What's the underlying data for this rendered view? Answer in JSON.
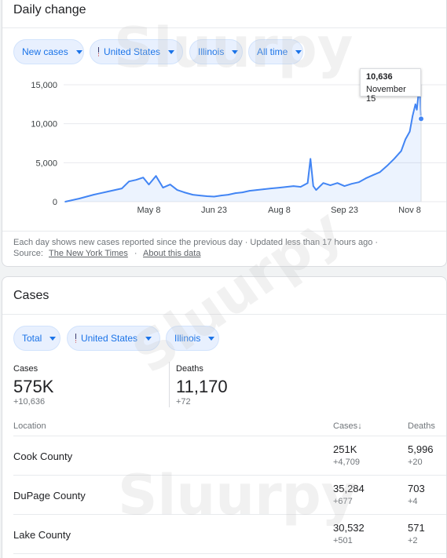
{
  "daily_change": {
    "title": "Daily change",
    "filters": {
      "metric": "New cases",
      "country": "United States",
      "region": "Illinois",
      "range": "All time"
    },
    "tooltip": {
      "value": "10,636",
      "date": "November 15"
    },
    "footer": {
      "note": "Each day shows new cases reported since the previous day · Updated less than 17 hours ago ·",
      "source_label": "Source:",
      "source_link": "The New York Times",
      "separator": "·",
      "about_link": "About this data"
    }
  },
  "chart_data": {
    "type": "line",
    "title": "",
    "xlabel": "",
    "ylabel": "",
    "y_ticks": [
      "15,000",
      "10,000",
      "5,000",
      "0"
    ],
    "x_ticks": [
      "May 8",
      "Jun 23",
      "Aug 8",
      "Sep 23",
      "Nov 8"
    ],
    "ylim": [
      0,
      15000
    ],
    "grid": true,
    "series": [
      {
        "color": "#4285f4",
        "x": [
          "Mar 10",
          "Mar 20",
          "Mar 30",
          "Apr 9",
          "Apr 19",
          "Apr 24",
          "Apr 29",
          "May 4",
          "May 8",
          "May 13",
          "May 18",
          "May 23",
          "May 28",
          "Jun 2",
          "Jun 8",
          "Jun 13",
          "Jun 18",
          "Jun 23",
          "Jun 28",
          "Jul 3",
          "Jul 8",
          "Jul 13",
          "Jul 18",
          "Jul 23",
          "Jul 28",
          "Aug 2",
          "Aug 8",
          "Aug 13",
          "Aug 18",
          "Aug 23",
          "Aug 28",
          "Aug 30",
          "Sep 1",
          "Sep 3",
          "Sep 8",
          "Sep 13",
          "Sep 18",
          "Sep 23",
          "Sep 28",
          "Oct 3",
          "Oct 8",
          "Oct 13",
          "Oct 18",
          "Oct 23",
          "Oct 28",
          "Nov 2",
          "Nov 5",
          "Nov 8",
          "Nov 10",
          "Nov 12",
          "Nov 13",
          "Nov 14",
          "Nov 15",
          "Nov 16"
        ],
        "values": [
          0,
          400,
          900,
          1300,
          1700,
          2600,
          2800,
          3100,
          2200,
          3300,
          1800,
          2200,
          1500,
          1200,
          900,
          800,
          700,
          650,
          800,
          900,
          1100,
          1200,
          1400,
          1500,
          1600,
          1700,
          1800,
          1900,
          2000,
          1900,
          2400,
          5500,
          2000,
          1500,
          2400,
          2100,
          2400,
          2000,
          2300,
          2500,
          3000,
          3400,
          3800,
          4600,
          5500,
          6500,
          8000,
          9000,
          11000,
          12500,
          11800,
          13500,
          15000,
          10636
        ]
      }
    ]
  },
  "cases_section": {
    "title": "Cases",
    "filters": {
      "metric": "Total",
      "country": "United States",
      "region": "Illinois"
    },
    "stats": {
      "cases": {
        "label": "Cases",
        "value": "575K",
        "delta": "+10,636"
      },
      "deaths": {
        "label": "Deaths",
        "value": "11,170",
        "delta": "+72"
      }
    },
    "table": {
      "headers": {
        "location": "Location",
        "cases": "Cases",
        "deaths": "Deaths"
      },
      "rows": [
        {
          "location": "Cook County",
          "cases": "251K",
          "cases_delta": "+4,709",
          "deaths": "5,996",
          "deaths_delta": "+20"
        },
        {
          "location": "DuPage County",
          "cases": "35,284",
          "cases_delta": "+677",
          "deaths": "703",
          "deaths_delta": "+4"
        },
        {
          "location": "Lake County",
          "cases": "30,532",
          "cases_delta": "+501",
          "deaths": "571",
          "deaths_delta": "+2"
        }
      ]
    }
  },
  "watermark": "Sluurpy",
  "colors": {
    "accent": "#1a73e8",
    "chip_bg": "#e8f0fe",
    "line": "#4285f4"
  },
  "icons": {
    "dropdown": "caret-down-icon",
    "flag": "us-flag-icon",
    "sort": "arrow-down-icon"
  }
}
